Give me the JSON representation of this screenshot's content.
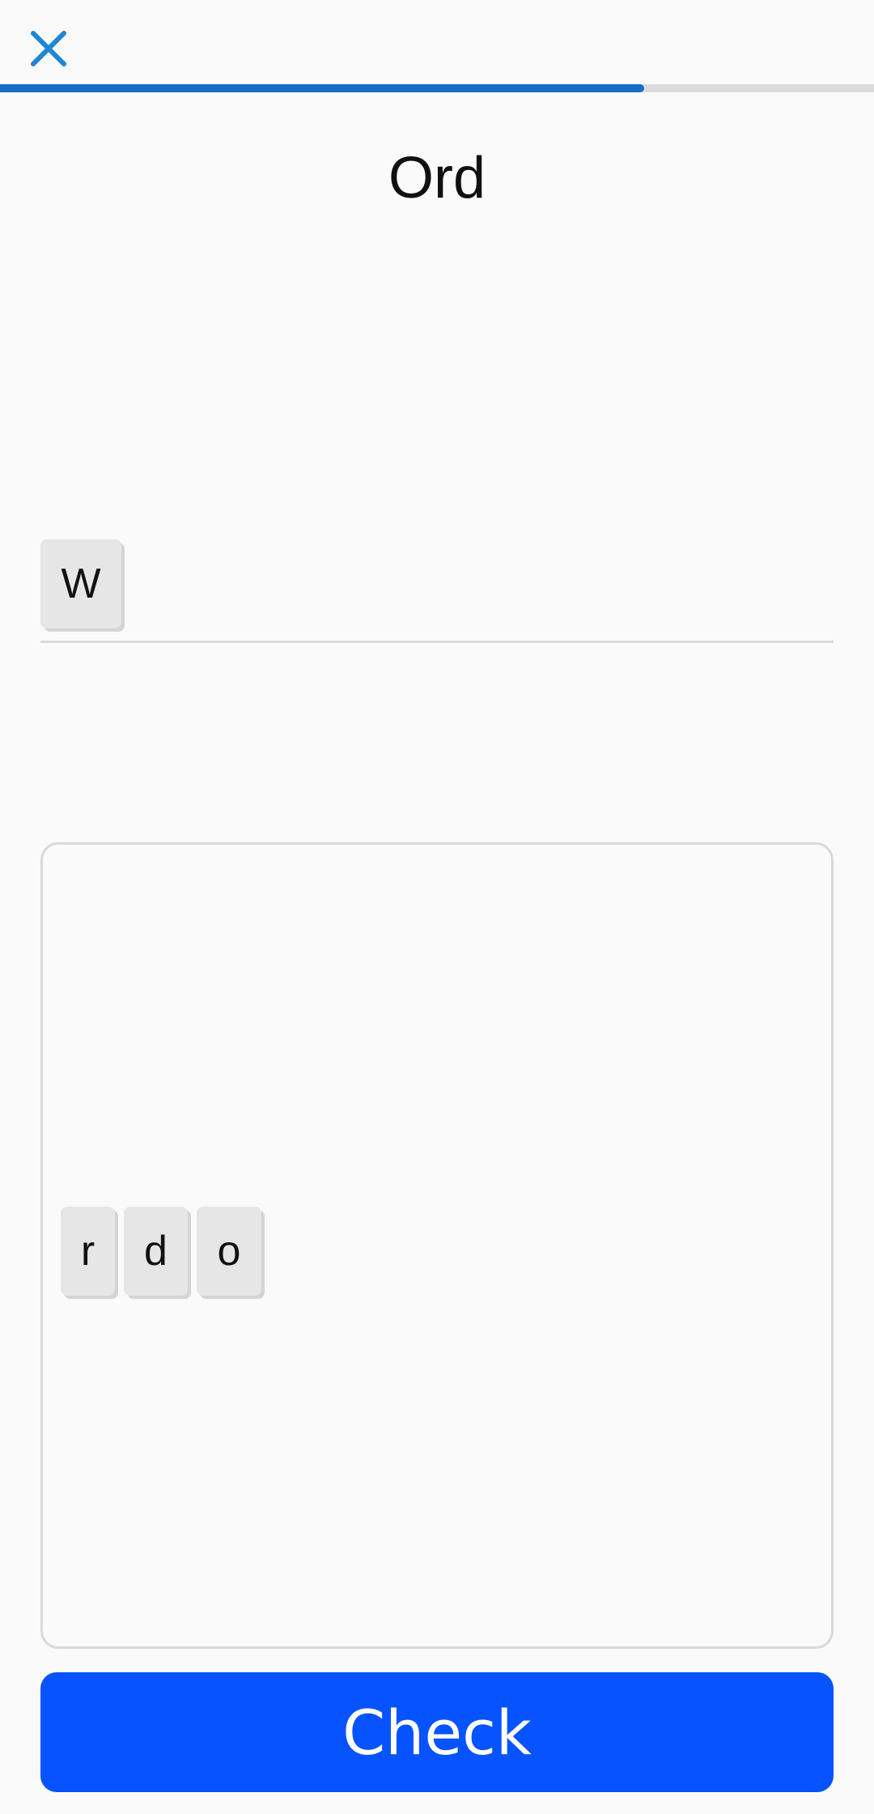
{
  "header": {
    "close_icon": "close-icon",
    "accent_color": "#1570c4",
    "progress": 0.737
  },
  "prompt": {
    "word": "Ord"
  },
  "answer": {
    "tiles": [
      "W"
    ]
  },
  "pool": {
    "tiles": [
      "r",
      "d",
      "o"
    ]
  },
  "footer": {
    "check_label": "Check",
    "check_color": "#0653ff"
  }
}
